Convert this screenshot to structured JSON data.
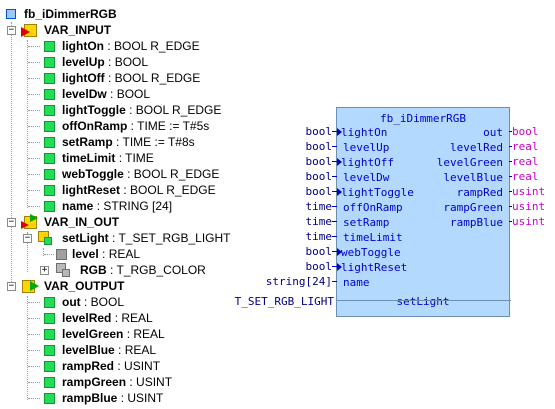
{
  "tree": {
    "root": "fb_iDimmerRGB",
    "var_input": {
      "label": "VAR_INPUT",
      "items": [
        {
          "name": "lightOn",
          "type": ": BOOL R_EDGE"
        },
        {
          "name": "levelUp",
          "type": ": BOOL"
        },
        {
          "name": "lightOff",
          "type": ": BOOL R_EDGE"
        },
        {
          "name": "levelDw",
          "type": ": BOOL"
        },
        {
          "name": "lightToggle",
          "type": ": BOOL R_EDGE"
        },
        {
          "name": "offOnRamp",
          "type": ": TIME := T#5s"
        },
        {
          "name": "setRamp",
          "type": ": TIME := T#8s"
        },
        {
          "name": "timeLimit",
          "type": ": TIME"
        },
        {
          "name": "webToggle",
          "type": ": BOOL R_EDGE"
        },
        {
          "name": "lightReset",
          "type": ": BOOL R_EDGE"
        },
        {
          "name": "name",
          "type": ": STRING [24]"
        }
      ]
    },
    "var_in_out": {
      "label": "VAR_IN_OUT",
      "setLight": {
        "name": "setLight",
        "type": ": T_SET_RGB_LIGHT"
      },
      "level": {
        "name": "level",
        "type": ": REAL"
      },
      "rgb": {
        "name": "RGB",
        "type": ": T_RGB_COLOR"
      }
    },
    "var_output": {
      "label": "VAR_OUTPUT",
      "items": [
        {
          "name": "out",
          "type": ": BOOL"
        },
        {
          "name": "levelRed",
          "type": ": REAL"
        },
        {
          "name": "levelGreen",
          "type": ": REAL"
        },
        {
          "name": "levelBlue",
          "type": ": REAL"
        },
        {
          "name": "rampRed",
          "type": ": USINT"
        },
        {
          "name": "rampGreen",
          "type": ": USINT"
        },
        {
          "name": "rampBlue",
          "type": ": USINT"
        }
      ]
    }
  },
  "block": {
    "title": "fb_iDimmerRGB",
    "inputs": [
      {
        "ext": "bool",
        "pin": "lightOn",
        "edge": true
      },
      {
        "ext": "bool",
        "pin": "levelUp",
        "edge": false
      },
      {
        "ext": "bool",
        "pin": "lightOff",
        "edge": true
      },
      {
        "ext": "bool",
        "pin": "levelDw",
        "edge": false
      },
      {
        "ext": "bool",
        "pin": "lightToggle",
        "edge": true
      },
      {
        "ext": "time",
        "pin": "offOnRamp",
        "edge": false
      },
      {
        "ext": "time",
        "pin": "setRamp",
        "edge": false
      },
      {
        "ext": "time",
        "pin": "timeLimit",
        "edge": false
      },
      {
        "ext": "bool",
        "pin": "webToggle",
        "edge": true
      },
      {
        "ext": "bool",
        "pin": "lightReset",
        "edge": true
      },
      {
        "ext": "string[24]",
        "pin": "name",
        "edge": false
      }
    ],
    "outputs": [
      {
        "pin": "out",
        "ext": "bool"
      },
      {
        "pin": "levelRed",
        "ext": "real"
      },
      {
        "pin": "levelGreen",
        "ext": "real"
      },
      {
        "pin": "levelBlue",
        "ext": "real"
      },
      {
        "pin": "rampRed",
        "ext": "usint"
      },
      {
        "pin": "rampGreen",
        "ext": "usint"
      },
      {
        "pin": "rampBlue",
        "ext": "usint"
      }
    ],
    "inout": {
      "ext": "T_SET_RGB_LIGHT",
      "pin": "setLight"
    }
  }
}
